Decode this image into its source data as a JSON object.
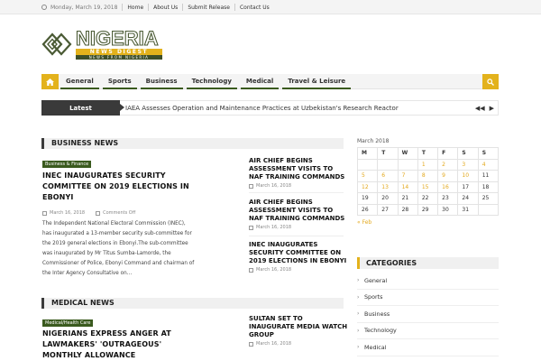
{
  "topbar": {
    "date": "Monday, March 19, 2018",
    "links": [
      "Home",
      "About Us",
      "Submit Release",
      "Contact Us"
    ]
  },
  "logo": {
    "title": "NIGERIA",
    "subtitle": "NEWS DIGEST",
    "tagline": "NEWS FROM NIGERIA"
  },
  "nav": {
    "home_icon": "home-icon",
    "items": [
      "General",
      "Sports",
      "Business",
      "Technology",
      "Medical",
      "Travel & Leisure"
    ],
    "search_icon": "search-icon"
  },
  "ticker": {
    "label": "Latest",
    "text": "IAEA Assesses Operation and Maintenance Practices at Uzbekistan's Research Reactor"
  },
  "business": {
    "section_title": "BUSINESS NEWS",
    "tag": "Business & Finance",
    "headline": "INEC INAUGURATES SECURITY COMMITTEE ON 2019 ELECTIONS IN EBONYI",
    "date": "March 16, 2018",
    "comments": "Comments Off",
    "excerpt": "The Independent National Electoral Commission (INEC), has inaugurated a 13-member security sub-committee for the 2019 general elections in Ebonyi.The sub-committee was inaugurated by Mr Titus Sumba-Lamorde, the Commissioner of Police, Ebonyi Command and chairman of the Inter Agency Consultative on…",
    "side": [
      {
        "title": "AIR CHIEF BEGINS ASSESSMENT VISITS TO NAF TRAINING COMMANDS",
        "date": "March 16, 2018"
      },
      {
        "title": "AIR CHIEF BEGINS ASSESSMENT VISITS TO NAF TRAINING COMMANDS",
        "date": "March 16, 2018"
      },
      {
        "title": "INEC INAUGURATES SECURITY COMMITTEE ON 2019 ELECTIONS IN EBONYI",
        "date": "March 16, 2018"
      }
    ]
  },
  "medical": {
    "section_title": "MEDICAL NEWS",
    "tag": "Medical/Health Care",
    "headline": "NIGERIANS EXPRESS ANGER AT LAWMAKERS' 'OUTRAGEOUS' MONTHLY ALLOWANCE",
    "side": [
      {
        "title": "SULTAN SET TO INAUGURATE MEDIA WATCH GROUP",
        "date": "March 16, 2018"
      }
    ]
  },
  "calendar": {
    "caption": "March 2018",
    "days": [
      "M",
      "T",
      "W",
      "T",
      "F",
      "S",
      "S"
    ],
    "weeks": [
      [
        "",
        "",
        "",
        "1",
        "2",
        "3",
        "4"
      ],
      [
        "5",
        "6",
        "7",
        "8",
        "9",
        "10",
        "11"
      ],
      [
        "12",
        "13",
        "14",
        "15",
        "16",
        "17",
        "18"
      ],
      [
        "19",
        "20",
        "21",
        "22",
        "23",
        "24",
        "25"
      ],
      [
        "26",
        "27",
        "28",
        "29",
        "30",
        "31",
        ""
      ]
    ],
    "linked_days": [
      "1",
      "2",
      "3",
      "4",
      "5",
      "6",
      "7",
      "8",
      "9",
      "10",
      "12",
      "13",
      "14",
      "15",
      "16"
    ],
    "prev": "« Feb"
  },
  "categories": {
    "title": "CATEGORIES",
    "items": [
      "General",
      "Sports",
      "Business",
      "Technology",
      "Medical"
    ]
  },
  "colors": {
    "accent": "#e3b21c",
    "green": "#3a5a1e",
    "dark": "#3a3a3a"
  }
}
